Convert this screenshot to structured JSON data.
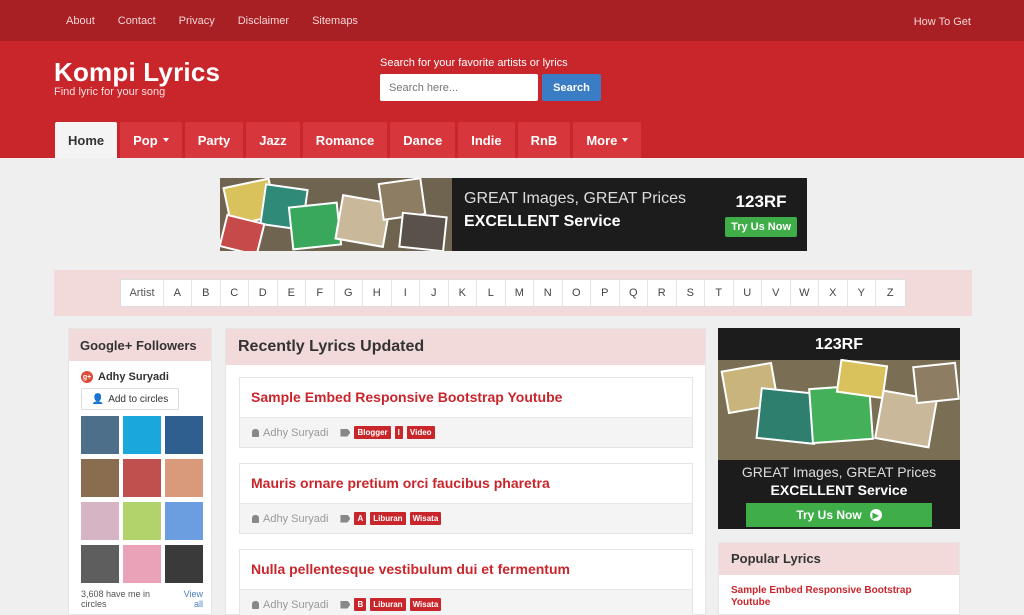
{
  "topnav": {
    "links": [
      "About",
      "Contact",
      "Privacy",
      "Disclaimer",
      "Sitemaps"
    ],
    "right": "How To Get"
  },
  "brand": {
    "title": "Kompi Lyrics",
    "tagline": "Find lyric for your song"
  },
  "search": {
    "label": "Search for your favorite artists or lyrics",
    "placeholder": "Search here...",
    "button": "Search"
  },
  "nav": {
    "tabs": [
      {
        "label": "Home",
        "active": true,
        "dropdown": false
      },
      {
        "label": "Pop",
        "active": false,
        "dropdown": true
      },
      {
        "label": "Party",
        "active": false,
        "dropdown": false
      },
      {
        "label": "Jazz",
        "active": false,
        "dropdown": false
      },
      {
        "label": "Romance",
        "active": false,
        "dropdown": false
      },
      {
        "label": "Dance",
        "active": false,
        "dropdown": false
      },
      {
        "label": "Indie",
        "active": false,
        "dropdown": false
      },
      {
        "label": "RnB",
        "active": false,
        "dropdown": false
      },
      {
        "label": "More",
        "active": false,
        "dropdown": true
      }
    ]
  },
  "banner": {
    "line1": "GREAT Images, GREAT Prices",
    "line2": "EXCELLENT Service",
    "logo": "123RF",
    "cta": "Try Us Now"
  },
  "alphabet": {
    "label": "Artist",
    "letters": [
      "A",
      "B",
      "C",
      "D",
      "E",
      "F",
      "G",
      "H",
      "I",
      "J",
      "K",
      "L",
      "M",
      "N",
      "O",
      "P",
      "Q",
      "R",
      "S",
      "T",
      "U",
      "V",
      "W",
      "X",
      "Y",
      "Z"
    ]
  },
  "gplus": {
    "title": "Google+ Followers",
    "user": "Adhy Suryadi",
    "add_label": "Add to circles",
    "footer_count": "3,608 have me in circles",
    "view_all": "View all",
    "avatar_colors": [
      "#4d6f8a",
      "#1aa7d9",
      "#2f5f8f",
      "#8a6d4e",
      "#c0504d",
      "#d89a7a",
      "#d7b4c4",
      "#b2d36b",
      "#6a9ee0",
      "#5e5e5e",
      "#e9a2b8",
      "#3a3a3a"
    ]
  },
  "recent": {
    "title": "Recently Lyrics Updated",
    "posts": [
      {
        "title": "Sample Embed Responsive Bootstrap Youtube",
        "author": "Adhy Suryadi",
        "tags": [
          "Blogger",
          "I",
          "Video"
        ]
      },
      {
        "title": "Mauris ornare pretium orci faucibus pharetra",
        "author": "Adhy Suryadi",
        "tags": [
          "A",
          "Liburan",
          "Wisata"
        ]
      },
      {
        "title": "Nulla pellentesque vestibulum dui et fermentum",
        "author": "Adhy Suryadi",
        "tags": [
          "B",
          "Liburan",
          "Wisata"
        ]
      }
    ]
  },
  "ad2": {
    "logo": "123RF",
    "line1": "GREAT Images, GREAT Prices",
    "line2": "EXCELLENT Service",
    "cta": "Try Us Now"
  },
  "popular": {
    "title": "Popular Lyrics",
    "first": "Sample Embed Responsive Bootstrap Youtube"
  },
  "colors": {
    "primary": "#c9262c",
    "topbar": "#a81f24",
    "accent_blue": "#3b7dc4",
    "green": "#3fae49",
    "pink_header": "#f2dadb"
  }
}
